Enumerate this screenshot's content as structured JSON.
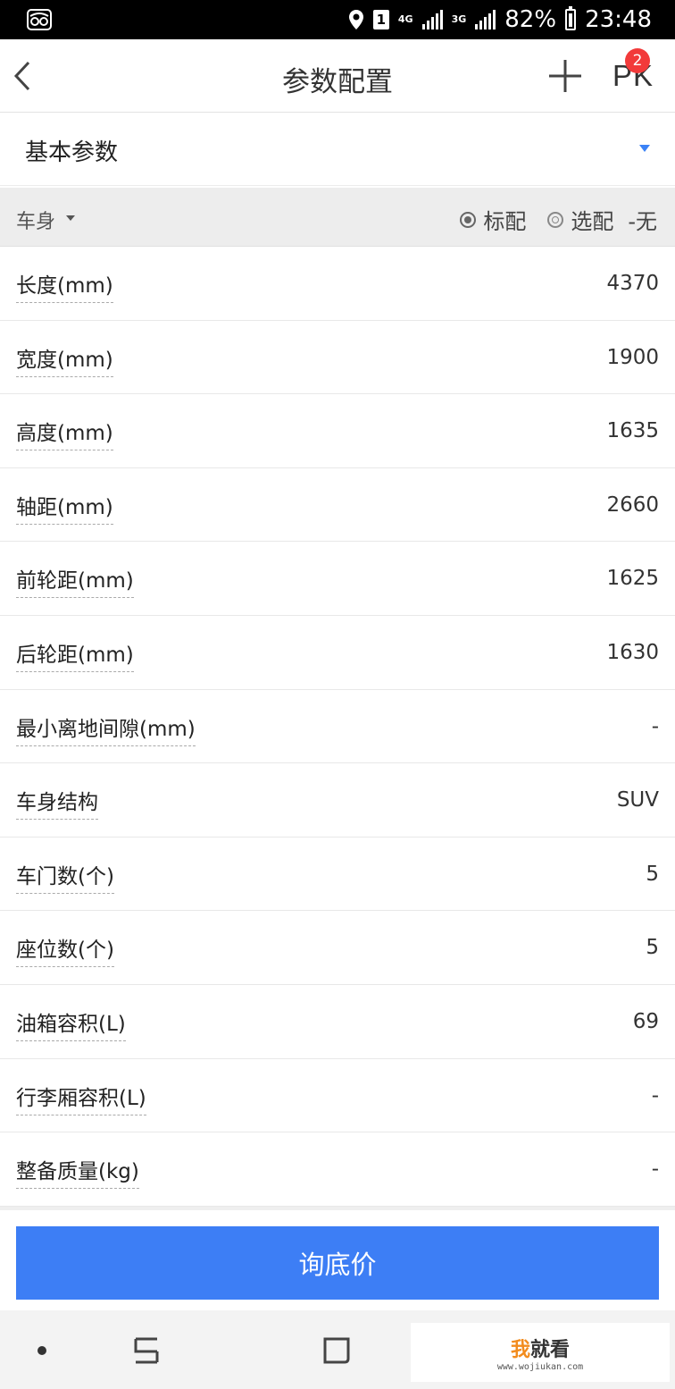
{
  "status_bar": {
    "network_4g": "4G",
    "network_3g": "3G",
    "sim_slot": "1",
    "battery": "82%",
    "time": "23:48"
  },
  "header": {
    "title": "参数配置",
    "pk_label": "PK",
    "pk_badge": "2"
  },
  "category": {
    "selected": "基本参数"
  },
  "section": {
    "title": "车身",
    "legend_standard": "标配",
    "legend_optional": "选配",
    "legend_none": "-无"
  },
  "specs": [
    {
      "label": "长度(mm)",
      "value": "4370"
    },
    {
      "label": "宽度(mm)",
      "value": "1900"
    },
    {
      "label": "高度(mm)",
      "value": "1635"
    },
    {
      "label": "轴距(mm)",
      "value": "2660"
    },
    {
      "label": "前轮距(mm)",
      "value": "1625"
    },
    {
      "label": "后轮距(mm)",
      "value": "1630"
    },
    {
      "label": "最小离地间隙(mm)",
      "value": "-"
    },
    {
      "label": "车身结构",
      "value": "SUV"
    },
    {
      "label": "车门数(个)",
      "value": "5"
    },
    {
      "label": "座位数(个)",
      "value": "5"
    },
    {
      "label": "油箱容积(L)",
      "value": "69"
    },
    {
      "label": "行李厢容积(L)",
      "value": "-"
    },
    {
      "label": "整备质量(kg)",
      "value": "-"
    }
  ],
  "bottom": {
    "inquire_label": "询底价"
  },
  "watermark": {
    "brand_prefix": "我",
    "brand_rest": "就看",
    "url": "www.wojiukan.com"
  },
  "colors": {
    "accent": "#3d7ef5",
    "badge": "#f23a3a"
  }
}
